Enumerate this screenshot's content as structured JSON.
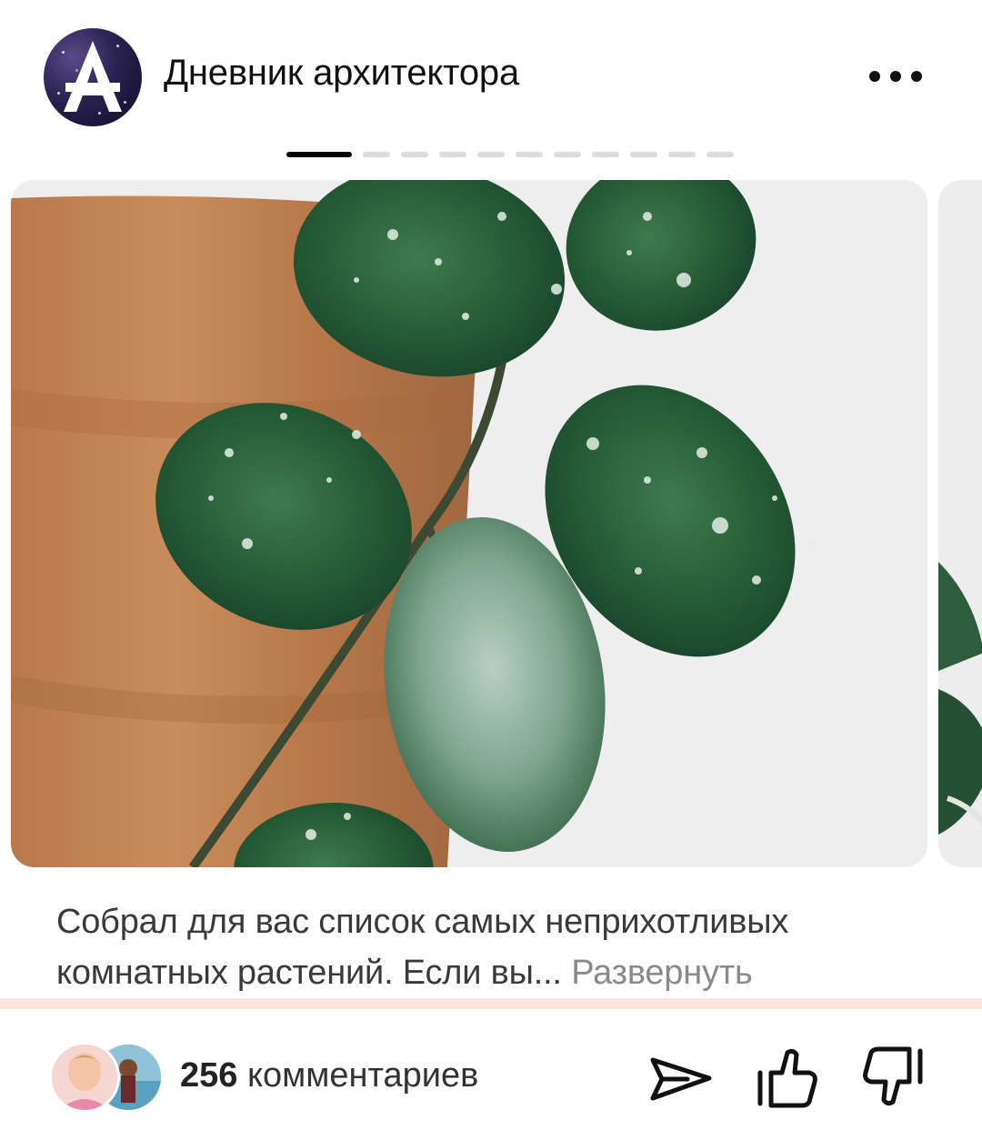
{
  "header": {
    "channel_name": "Дневник архитектора",
    "avatar_letter": "A",
    "more_icon": "more-horizontal-icon"
  },
  "carousel": {
    "total_slides": 11,
    "active_slide": 1
  },
  "post": {
    "text": "Собрал для вас список самых неприхотливых комнатных растений. Если вы... ",
    "expand_label": "Развернуть"
  },
  "footer": {
    "comments_count": "256",
    "comments_label": " комментариев",
    "icons": [
      "share-send-icon",
      "thumbs-up-icon",
      "thumbs-down-icon"
    ]
  },
  "colors": {
    "divider": "#fbe5dc",
    "text": "#3a3a3a",
    "expand": "#8a8a8a"
  }
}
